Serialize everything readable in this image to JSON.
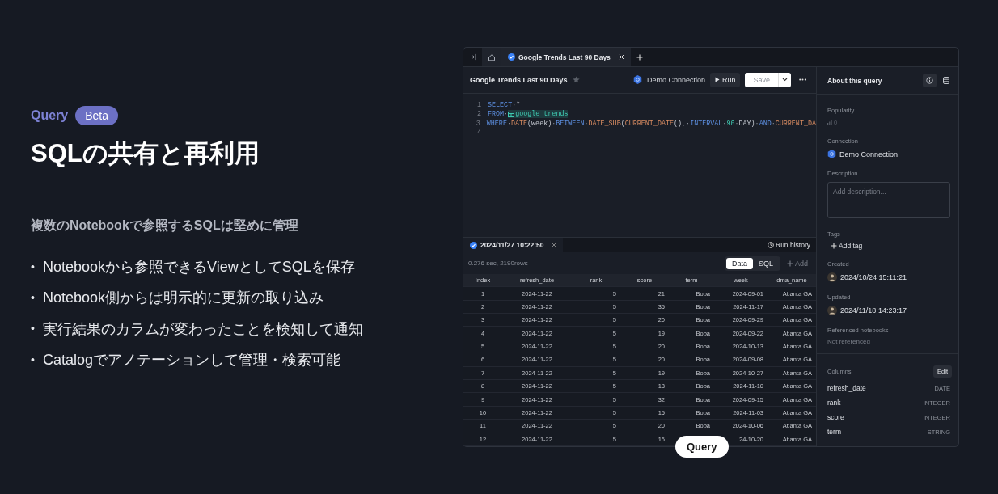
{
  "intro": {
    "label": "Query",
    "badge": "Beta",
    "title": "SQLの共有と再利用",
    "subtitle": "複数のNotebookで参照するSQLは堅めに管理",
    "bullets": [
      {
        "marker": "•",
        "text": "Notebookから参照できるViewとしてSQLを保存"
      },
      {
        "marker": "•",
        "text": "Notebook側からは明示的に更新の取り込み"
      },
      {
        "marker": "•",
        "text": "実行結果のカラムが変わったことを検知して通知"
      },
      {
        "marker": "•",
        "text": "Catalogでアノテーションして管理・検索可能"
      }
    ]
  },
  "tabs": [
    {
      "label": "Google Trends Last 90 Days",
      "selected": true
    }
  ],
  "query": {
    "title": "Google Trends Last 90 Days",
    "connection": "Demo Connection",
    "run": "Run",
    "save": "Save",
    "save_disabled": true
  },
  "code": [
    {
      "number": "1",
      "tokens": [
        {
          "t": "SELECT",
          "kind": "kw"
        },
        {
          "t": "·",
          "kind": "ws"
        },
        {
          "t": "*",
          "kind": "id"
        }
      ]
    },
    {
      "number": "2",
      "tokens": [
        {
          "t": "FROM",
          "kind": "kw"
        },
        {
          "t": "·",
          "kind": "ws"
        },
        {
          "t": "google_trends",
          "kind": "tbl"
        }
      ]
    },
    {
      "number": "3",
      "tokens": [
        {
          "t": "WHERE",
          "kind": "kw"
        },
        {
          "t": "·",
          "kind": "ws"
        },
        {
          "t": "DATE",
          "kind": "fn"
        },
        {
          "t": "(week)",
          "kind": "id"
        },
        {
          "t": "·",
          "kind": "ws"
        },
        {
          "t": "BETWEEN",
          "kind": "kw"
        },
        {
          "t": "·",
          "kind": "ws"
        },
        {
          "t": "DATE_SUB",
          "kind": "fn"
        },
        {
          "t": "(",
          "kind": "id"
        },
        {
          "t": "CURRENT_DATE",
          "kind": "fn"
        },
        {
          "t": "(),",
          "kind": "id"
        },
        {
          "t": "·",
          "kind": "ws"
        },
        {
          "t": "INTERVAL",
          "kind": "kw"
        },
        {
          "t": "·",
          "kind": "ws"
        },
        {
          "t": "90",
          "kind": "num"
        },
        {
          "t": "·",
          "kind": "ws"
        },
        {
          "t": "DAY)",
          "kind": "id"
        },
        {
          "t": "·",
          "kind": "ws"
        },
        {
          "t": "AND",
          "kind": "kw"
        },
        {
          "t": "·",
          "kind": "ws"
        },
        {
          "t": "CURRENT_DA",
          "kind": "fn"
        }
      ]
    },
    {
      "number": "4",
      "cursor": true
    }
  ],
  "results": {
    "tab": "2024/11/27 10:22:50",
    "run_history": "Run history",
    "stats": "0.276 sec, 2190rows",
    "views": [
      {
        "label": "Data",
        "selected": true
      },
      {
        "label": "SQL",
        "selected": false
      }
    ],
    "add": "Add",
    "add_disabled": true
  },
  "table": {
    "columns": [
      "Index",
      "refresh_date",
      "rank",
      "score",
      "term",
      "week",
      "dma_name"
    ],
    "rows": [
      [
        "1",
        "2024-11-22",
        "5",
        "21",
        "Boba",
        "2024-09-01",
        "Atlanta GA"
      ],
      [
        "2",
        "2024-11-22",
        "5",
        "35",
        "Boba",
        "2024-11-17",
        "Atlanta GA"
      ],
      [
        "3",
        "2024-11-22",
        "5",
        "20",
        "Boba",
        "2024-09-29",
        "Atlanta GA"
      ],
      [
        "4",
        "2024-11-22",
        "5",
        "19",
        "Boba",
        "2024-09-22",
        "Atlanta GA"
      ],
      [
        "5",
        "2024-11-22",
        "5",
        "20",
        "Boba",
        "2024-10-13",
        "Atlanta GA"
      ],
      [
        "6",
        "2024-11-22",
        "5",
        "20",
        "Boba",
        "2024-09-08",
        "Atlanta GA"
      ],
      [
        "7",
        "2024-11-22",
        "5",
        "19",
        "Boba",
        "2024-10-27",
        "Atlanta GA"
      ],
      [
        "8",
        "2024-11-22",
        "5",
        "18",
        "Boba",
        "2024-11-10",
        "Atlanta GA"
      ],
      [
        "9",
        "2024-11-22",
        "5",
        "32",
        "Boba",
        "2024-09-15",
        "Atlanta GA"
      ],
      [
        "10",
        "2024-11-22",
        "5",
        "15",
        "Boba",
        "2024-11-03",
        "Atlanta GA"
      ],
      [
        "11",
        "2024-11-22",
        "5",
        "20",
        "Boba",
        "2024-10-06",
        "Atlanta GA"
      ],
      [
        "12",
        "2024-11-22",
        "5",
        "16",
        null,
        "24-10-20",
        "Atlanta GA"
      ]
    ]
  },
  "sidebar": {
    "title": "About this query",
    "popularity_label": "Popularity",
    "popularity": "0",
    "connection_label": "Connection",
    "connection": "Demo Connection",
    "description_label": "Description",
    "description_placeholder": "Add description...",
    "tags_label": "Tags",
    "add_tag": "Add tag",
    "created_label": "Created",
    "created": "2024/10/24 15:11:21",
    "updated_label": "Updated",
    "updated": "2024/11/18 14:23:17",
    "referenced_label": "Referenced notebooks",
    "referenced": "Not referenced",
    "columns_label": "Columns",
    "edit": "Edit",
    "columns": [
      {
        "name": "refresh_date",
        "type": "DATE"
      },
      {
        "name": "rank",
        "type": "INTEGER"
      },
      {
        "name": "score",
        "type": "INTEGER"
      },
      {
        "name": "term",
        "type": "STRING"
      }
    ]
  },
  "pill": "Query"
}
